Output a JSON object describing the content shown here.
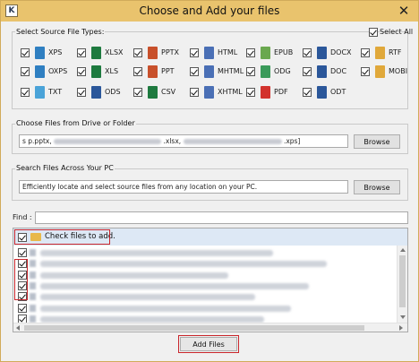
{
  "window": {
    "title": "Choose and Add your files",
    "logo_letter": "K",
    "close_glyph": "✕"
  },
  "source_types": {
    "group_label": "Select Source File Types:",
    "select_all_label": "Select All",
    "select_all_checked": true,
    "items": [
      {
        "label": "XPS",
        "checked": true,
        "icon": "xps-file-icon",
        "color": "#2f7fc1"
      },
      {
        "label": "XLSX",
        "checked": true,
        "icon": "excel-file-icon",
        "color": "#1e7a3f"
      },
      {
        "label": "PPTX",
        "checked": true,
        "icon": "powerpoint-file-icon",
        "color": "#c8502b"
      },
      {
        "label": "HTML",
        "checked": true,
        "icon": "html-file-icon",
        "color": "#4a6fb5"
      },
      {
        "label": "EPUB",
        "checked": true,
        "icon": "epub-file-icon",
        "color": "#6aa84f"
      },
      {
        "label": "DOCX",
        "checked": true,
        "icon": "word-file-icon",
        "color": "#2b579a"
      },
      {
        "label": "RTF",
        "checked": true,
        "icon": "rtf-file-icon",
        "color": "#e0a83a"
      },
      {
        "label": "OXPS",
        "checked": true,
        "icon": "oxps-file-icon",
        "color": "#2f7fc1"
      },
      {
        "label": "XLS",
        "checked": true,
        "icon": "excel-file-icon",
        "color": "#1e7a3f"
      },
      {
        "label": "PPT",
        "checked": true,
        "icon": "powerpoint-file-icon",
        "color": "#c8502b"
      },
      {
        "label": "MHTML",
        "checked": true,
        "icon": "mhtml-file-icon",
        "color": "#4a6fb5"
      },
      {
        "label": "ODG",
        "checked": true,
        "icon": "odg-file-icon",
        "color": "#3a9a5a"
      },
      {
        "label": "DOC",
        "checked": true,
        "icon": "word-file-icon",
        "color": "#2b579a"
      },
      {
        "label": "MOBI",
        "checked": true,
        "icon": "mobi-file-icon",
        "color": "#e0a83a"
      },
      {
        "label": "TXT",
        "checked": true,
        "icon": "txt-file-icon",
        "color": "#4aa3d8"
      },
      {
        "label": "ODS",
        "checked": true,
        "icon": "ods-file-icon",
        "color": "#2b579a"
      },
      {
        "label": "CSV",
        "checked": true,
        "icon": "csv-file-icon",
        "color": "#1e7a3f"
      },
      {
        "label": "XHTML",
        "checked": true,
        "icon": "xhtml-file-icon",
        "color": "#4a6fb5"
      },
      {
        "label": "PDF",
        "checked": true,
        "icon": "pdf-file-icon",
        "color": "#d2322d"
      },
      {
        "label": "ODT",
        "checked": true,
        "icon": "odt-file-icon",
        "color": "#2b579a"
      }
    ]
  },
  "choose_files": {
    "group_label": "Choose Files from Drive or Folder",
    "path_value": "s p.pptx,",
    "path_value_mid": ".xlsx,",
    "path_value_end": ".xps]",
    "browse_label": "Browse"
  },
  "search_pc": {
    "group_label": "Search Files Across Your PC",
    "description": "Efficiently locate and select source files from any location on your PC.",
    "browse_label": "Browse"
  },
  "find": {
    "label": "Find :",
    "value": ""
  },
  "file_list": {
    "header_label": "Check files to add.",
    "header_checked": true,
    "rows_checked": [
      true,
      true,
      true,
      true,
      true,
      true,
      true
    ]
  },
  "footer": {
    "add_files_label": "Add Files"
  },
  "colors": {
    "titlebar": "#e9c36d",
    "highlight": "#c9262c",
    "list_header": "#dde8f5"
  }
}
